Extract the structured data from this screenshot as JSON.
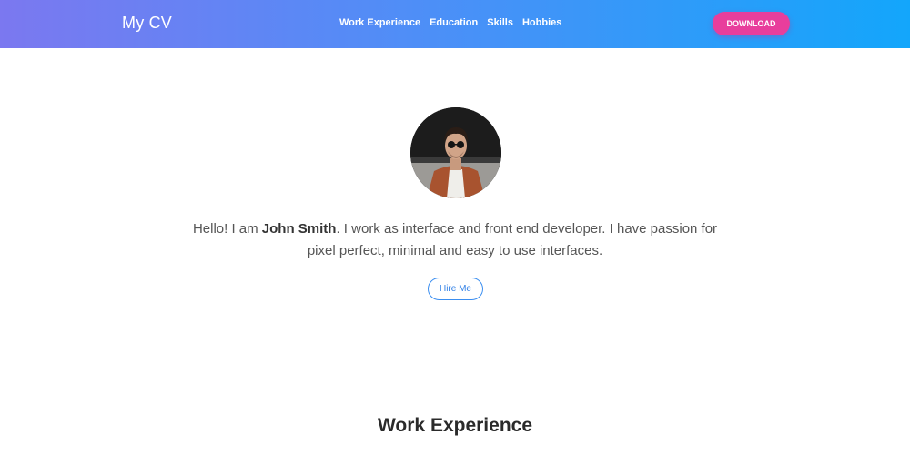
{
  "navbar": {
    "brand": "My CV",
    "links": [
      "Work Experience",
      "Education",
      "Skills",
      "Hobbies"
    ],
    "download_label": "DOWNLOAD",
    "gradient_start": "#7b78f0",
    "gradient_end": "#13a6fb",
    "download_color": "#e83e9c"
  },
  "hero": {
    "intro_before": "Hello! I am ",
    "name": "John Smith",
    "intro_after": ". I work as interface and front end developer. I have passion for pixel perfect, minimal and easy to use interfaces.",
    "hire_label": "Hire Me"
  },
  "sections": {
    "work_title": "Work Experience"
  }
}
